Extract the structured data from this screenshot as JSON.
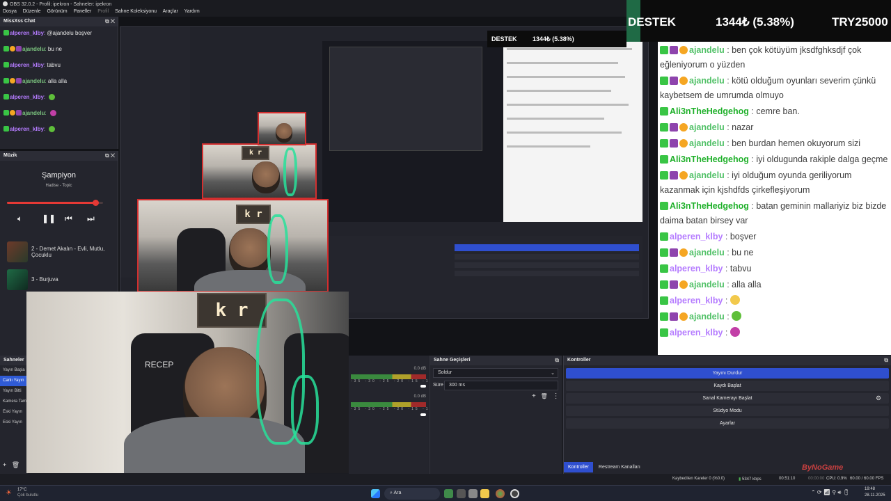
{
  "window": {
    "title": "OBS 32.0.2 - Profil: ipekron - Sahneler: ipekron",
    "menu": [
      "Dosya",
      "Düzenle",
      "Görünüm",
      "Paneller",
      "Profil",
      "Sahne Koleksiyonu",
      "Araçlar",
      "Yardım"
    ]
  },
  "ticker": {
    "items": [
      "DESTEK",
      "1344₺ (5.38%)",
      "TRY25000"
    ]
  },
  "chat_dock": {
    "title": "MissXss Chat",
    "messages": [
      {
        "name": "alperen_klby",
        "sep": ":",
        "text": "@ajandelu boşver",
        "color": "#b57cff"
      },
      {
        "name": "ajandelu",
        "sep": ":",
        "text": "bu ne",
        "color": "#7cc57f"
      },
      {
        "name": "alperen_klby",
        "sep": ":",
        "text": "tabvu",
        "color": "#b57cff"
      },
      {
        "name": "ajandelu",
        "sep": ":",
        "text": "alla alla",
        "color": "#7cc57f"
      },
      {
        "name": "alperen_klby",
        "sep": ":",
        "text": "",
        "color": "#b57cff"
      },
      {
        "name": "ajandelu",
        "sep": ":",
        "text": "",
        "color": "#7cc57f"
      },
      {
        "name": "alperen_klby",
        "sep": ":",
        "text": "",
        "color": "#b57cff"
      }
    ]
  },
  "music": {
    "dock_title": "Müzik",
    "song": "Şampiyon",
    "artist": "Hadise - Topic",
    "progress": 0.92,
    "tracks": [
      "2 - Demet Akalın - Evli, Mutlu, Çocuklu",
      "3 - Burjuva"
    ]
  },
  "scenes": {
    "title": "Sahneler",
    "items": [
      "Yayın Başla",
      "Canlı Yayın",
      "Yayın Bitti",
      "Kamera Tam",
      "Eski Yayın",
      "Eski Yayın"
    ],
    "selected": 1
  },
  "mixer": {
    "db_labels": [
      "0.0 dB",
      "0.0 dB"
    ],
    "scale": "-35 -30 -25 -20 -15 -10 -5 0"
  },
  "transitions": {
    "title": "Sahne Geçişleri",
    "transition": "Soldur",
    "duration_label": "Süre",
    "duration_value": "300 ms"
  },
  "controls": {
    "title": "Kontroller",
    "buttons": [
      "Yayını Durdur",
      "Kaydı Başlat",
      "Sanal Kamerayı Başlat",
      "Stüdyo Modu",
      "Ayarlar"
    ],
    "tabs": [
      "Kontroller",
      "Restream Kanalları"
    ]
  },
  "status": {
    "dropped": "Kaybedilen Kareler 0 (%0.0)",
    "bitrate": "5347 kbps",
    "stream_time": "00:51:10",
    "rec_time": "00:00:00",
    "cpu": "CPU: 0.9%",
    "fps": "60.00 / 60.00 FPS"
  },
  "big_chat": {
    "messages": [
      {
        "name": "ajandelu",
        "text": "ben çok kötüyüm jksdfghksdjf çok eğleniyorum o yüzden",
        "color": "#52c168",
        "badges": [
          "green",
          "purple",
          "orange"
        ]
      },
      {
        "name": "ajandelu",
        "text": "kötü olduğum oyunları severim çünkü kaybetsem de umrumda olmuyo",
        "color": "#52c168",
        "badges": [
          "green",
          "purple",
          "orange"
        ]
      },
      {
        "name": "Ali3nTheHedgehog",
        "text": "cemre ban.",
        "color": "#1fb02a",
        "badges": [
          "green"
        ]
      },
      {
        "name": "ajandelu",
        "text": "nazar",
        "color": "#52c168",
        "badges": [
          "green",
          "purple",
          "orange"
        ]
      },
      {
        "name": "ajandelu",
        "text": "ben burdan hemen okuyorum sizi",
        "color": "#52c168",
        "badges": [
          "green",
          "purple",
          "orange"
        ]
      },
      {
        "name": "Ali3nTheHedgehog",
        "text": "iyi oldugunda rakiple dalga geçme",
        "color": "#1fb02a",
        "badges": [
          "green"
        ]
      },
      {
        "name": "ajandelu",
        "text": "iyi olduğum oyunda geriliyorum kazanmak için kjshdfds çirkefleşiyorum",
        "color": "#52c168",
        "badges": [
          "green",
          "purple",
          "orange"
        ]
      },
      {
        "name": "Ali3nTheHedgehog",
        "text": "batan geminin mallariyiz biz bizde daima batan birsey var",
        "color": "#1fb02a",
        "badges": [
          "green"
        ]
      },
      {
        "name": "alperen_klby",
        "text": "boşver",
        "color": "#b57cff",
        "badges": [
          "green"
        ]
      },
      {
        "name": "ajandelu",
        "text": "bu ne",
        "color": "#52c168",
        "badges": [
          "green",
          "purple",
          "orange"
        ]
      },
      {
        "name": "alperen_klby",
        "text": "tabvu",
        "color": "#b57cff",
        "badges": [
          "green"
        ]
      },
      {
        "name": "ajandelu",
        "text": "alla alla",
        "color": "#52c168",
        "badges": [
          "green",
          "purple",
          "orange"
        ]
      },
      {
        "name": "alperen_klby",
        "text": "",
        "color": "#b57cff",
        "badges": [
          "green"
        ],
        "emoji": "#f2c94c"
      },
      {
        "name": "ajandelu",
        "text": "",
        "color": "#52c168",
        "badges": [
          "green",
          "purple",
          "orange"
        ],
        "emoji": "#5fbf3a"
      },
      {
        "name": "alperen_klby",
        "text": "",
        "color": "#b57cff",
        "badges": [
          "green"
        ],
        "emoji": "#c23fa7"
      }
    ]
  },
  "taskbar": {
    "weather_temp": "17°C",
    "weather_desc": "Çok bulutlu",
    "search": "Ara",
    "time": "19:48",
    "date": "28.11.2025"
  },
  "overlay": {
    "sign_text": "k r",
    "chair_text": "RECEP",
    "watermark": "ByNoGame"
  },
  "colors": {
    "accent": "#2f4fcf",
    "red": "#e53935",
    "neon": "#28e09a"
  }
}
